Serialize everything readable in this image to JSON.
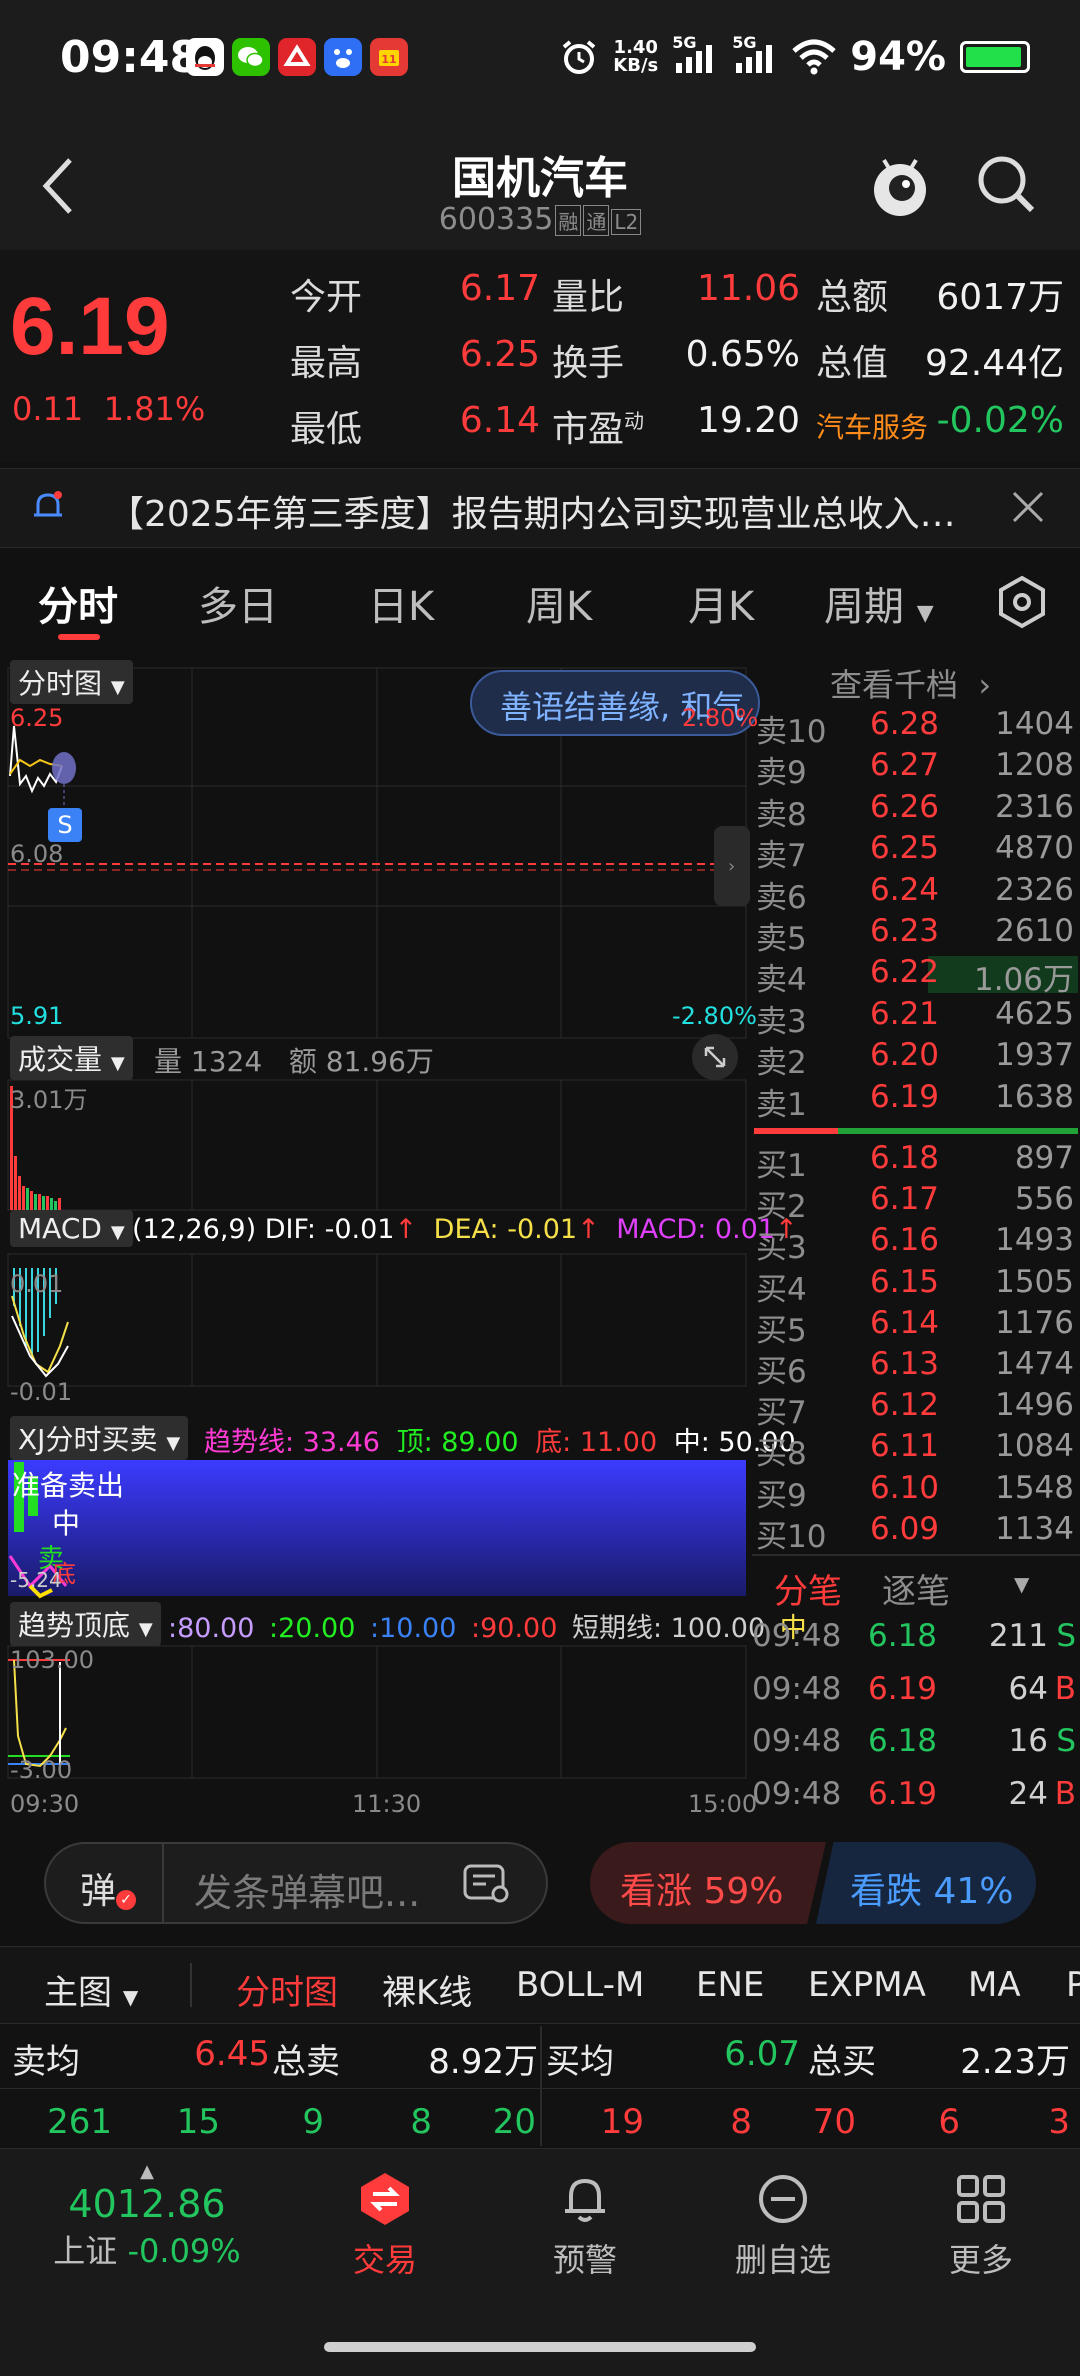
{
  "status_bar": {
    "time": "09:48",
    "net_speed_value": "1.40",
    "net_speed_unit": "KB/s",
    "signal1": "5G",
    "signal2": "5G",
    "battery": "94%",
    "battery_level": 0.94
  },
  "header": {
    "title": "国机汽车",
    "code": "600335",
    "tags": [
      "融",
      "通",
      "L2"
    ]
  },
  "quote": {
    "price": "6.19",
    "change": "0.11",
    "change_pct": "1.81%",
    "rows": [
      {
        "l1": "今开",
        "v1": "6.17",
        "l2": "量比",
        "v2": "11.06",
        "l3": "总额",
        "v3": "6017万"
      },
      {
        "l1": "最高",
        "v1": "6.25",
        "l2": "换手",
        "v2": "0.65%",
        "l3": "总值",
        "v3": "92.44亿"
      },
      {
        "l1": "最低",
        "v1": "6.14",
        "l2": "市盈",
        "l2_sup": "动",
        "v2": "19.20",
        "l3": "汽车服务",
        "v3": "-0.02%"
      }
    ]
  },
  "notice": {
    "text": "【2025年第三季度】报告期内公司实现营业总收入…"
  },
  "tabs": [
    "分时",
    "多日",
    "日K",
    "周K",
    "月K",
    "周期"
  ],
  "chart": {
    "main_label": "分时图",
    "banner": "善语结善缘, 和气",
    "price_high": "6.25",
    "price_mid": "6.08",
    "price_low": "5.91",
    "pct_high": "2.80%",
    "pct_low": "-2.80%",
    "marker": "S",
    "vol_label": "成交量",
    "vol_info": "量 1324   额 81.96万",
    "vol_max": "3.01万",
    "macd_label": "MACD",
    "macd_params": "(12,26,9)",
    "macd_dif": "DIF: -0.01",
    "macd_dea": "DEA: -0.01",
    "macd_val": "MACD: 0.01",
    "macd_top": "0.01",
    "macd_bottom": "-0.01",
    "xj_label": "XJ分时买卖",
    "xj_trend": "趋势线: 33.46",
    "xj_top": "顶: 89.00",
    "xj_bottom": "底: 11.00",
    "xj_mid": "中: 50.00",
    "xj_text1": "准备卖出",
    "xj_text2": "中",
    "xj_text3": "卖",
    "xj_text4": "底",
    "xj_low": "-5.24",
    "trend_label": "趋势顶底",
    "trend_vals": [
      ":80.00",
      ":20.00",
      ":10.00",
      ":90.00",
      "短期线: 100.00",
      "中"
    ],
    "trend_top": "103.00",
    "trend_bottom": "-3.00",
    "time_start": "09:30",
    "time_mid": "11:30",
    "time_end": "15:00"
  },
  "order_book": {
    "header": "查看千档",
    "asks": [
      {
        "label": "卖10",
        "price": "6.28",
        "vol": "1404"
      },
      {
        "label": "卖9",
        "price": "6.27",
        "vol": "1208"
      },
      {
        "label": "卖8",
        "price": "6.26",
        "vol": "2316"
      },
      {
        "label": "卖7",
        "price": "6.25",
        "vol": "4870"
      },
      {
        "label": "卖6",
        "price": "6.24",
        "vol": "2326"
      },
      {
        "label": "卖5",
        "price": "6.23",
        "vol": "2610"
      },
      {
        "label": "卖4",
        "price": "6.22",
        "vol": "1.06万"
      },
      {
        "label": "卖3",
        "price": "6.21",
        "vol": "4625"
      },
      {
        "label": "卖2",
        "price": "6.20",
        "vol": "1937"
      },
      {
        "label": "卖1",
        "price": "6.19",
        "vol": "1638"
      }
    ],
    "bids": [
      {
        "label": "买1",
        "price": "6.18",
        "vol": "897"
      },
      {
        "label": "买2",
        "price": "6.17",
        "vol": "556"
      },
      {
        "label": "买3",
        "price": "6.16",
        "vol": "1493"
      },
      {
        "label": "买4",
        "price": "6.15",
        "vol": "1505"
      },
      {
        "label": "买5",
        "price": "6.14",
        "vol": "1176"
      },
      {
        "label": "买6",
        "price": "6.13",
        "vol": "1474"
      },
      {
        "label": "买7",
        "price": "6.12",
        "vol": "1496"
      },
      {
        "label": "买8",
        "price": "6.11",
        "vol": "1084"
      },
      {
        "label": "买9",
        "price": "6.10",
        "vol": "1548"
      },
      {
        "label": "买10",
        "price": "6.09",
        "vol": "1134"
      }
    ],
    "tick_tabs": [
      "分笔",
      "逐笔"
    ],
    "ticks": [
      {
        "time": "09:48",
        "price": "6.18",
        "vol": "211",
        "side": "S"
      },
      {
        "time": "09:48",
        "price": "6.19",
        "vol": "64",
        "side": "B"
      },
      {
        "time": "09:48",
        "price": "6.18",
        "vol": "16",
        "side": "S"
      },
      {
        "time": "09:48",
        "price": "6.19",
        "vol": "24",
        "side": "B"
      }
    ]
  },
  "barrage": {
    "icon_text": "弹",
    "placeholder": "发条弹幕吧...",
    "up": "看涨 59%",
    "down": "看跌 41%",
    "up_ratio": 0.59
  },
  "indicators": [
    "主图",
    "分时图",
    "裸K线",
    "BOLL-M",
    "ENE",
    "EXPMA",
    "MA",
    "P"
  ],
  "summary": {
    "sell_avg_label": "卖均",
    "sell_avg": "6.45",
    "sell_total_label": "总卖",
    "sell_total": "8.92万",
    "buy_avg_label": "买均",
    "buy_avg": "6.07",
    "buy_total_label": "总买",
    "buy_total": "2.23万",
    "left_nums": [
      "261",
      "15",
      "9",
      "8",
      "20"
    ],
    "right_nums": [
      "19",
      "8",
      "70",
      "6",
      "3"
    ]
  },
  "bottom_nav": {
    "index_value": "4012.86",
    "index_name": "上证",
    "index_change": "-0.09%",
    "items": [
      "交易",
      "预警",
      "删自选",
      "更多"
    ]
  },
  "colors": {
    "up": "#ff3b3b",
    "down": "#22c55e",
    "bg": "#111111"
  }
}
